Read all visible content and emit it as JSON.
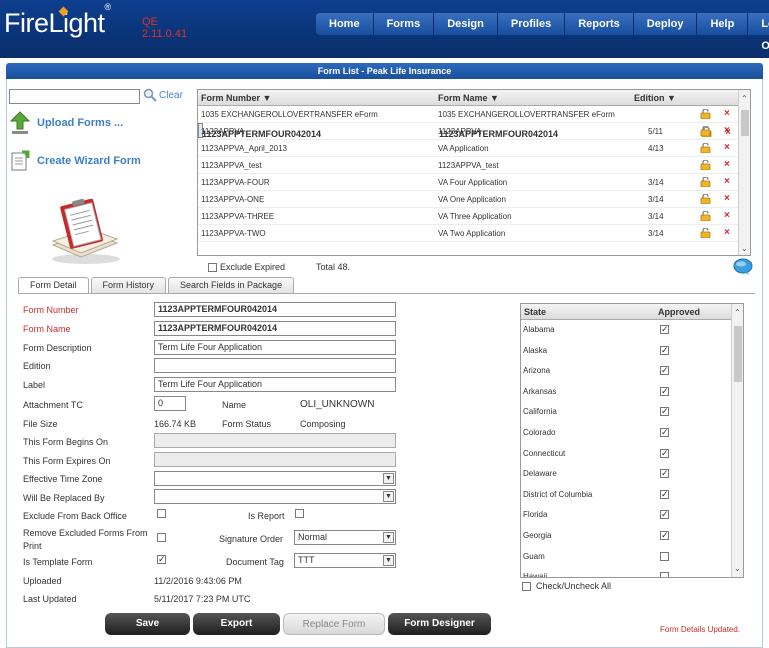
{
  "header": {
    "logo_text": "FireLight",
    "logo_reg": "®",
    "env": "QE",
    "version": "2.11.0.41",
    "nav": [
      "Home",
      "Forms",
      "Design",
      "Profiles",
      "Reports",
      "Deploy",
      "Help",
      "Log Off"
    ]
  },
  "page_title": "Form List - Peak Life Insurance",
  "left": {
    "search_value": "",
    "clear_label": "Clear",
    "upload_label": "Upload Forms ...",
    "wizard_label": "Create Wizard Form"
  },
  "forms_table": {
    "columns": [
      "Form Number ▼",
      "Form Name ▼",
      "Edition ▼"
    ],
    "rows": [
      {
        "number": "1035 EXCHANGEROLLOVERTRANSFER eForm",
        "name": "1035 EXCHANGEROLLOVERTRANSFER eForm",
        "edition": ""
      },
      {
        "number": "1123APPTERMFOUR042014",
        "name": "1123APPTERMFOUR042014",
        "edition": ""
      },
      {
        "number": "1123APPVA",
        "name": "1123APPVA",
        "edition": "5/11"
      },
      {
        "number": "1123APPVA_April_2013",
        "name": "VA Application",
        "edition": "4/13"
      },
      {
        "number": "1123APPVA_test",
        "name": "1123APPVA_test",
        "edition": ""
      },
      {
        "number": "1123APPVA-FOUR",
        "name": "VA Four Application",
        "edition": "3/14"
      },
      {
        "number": "1123APPVA-ONE",
        "name": "VA One Application",
        "edition": "3/14"
      },
      {
        "number": "1123APPVA-THREE",
        "name": "VA Three Application",
        "edition": "3/14"
      },
      {
        "number": "1123APPVA-TWO",
        "name": "VA Two Application",
        "edition": "3/14"
      }
    ],
    "delete_glyph": "×"
  },
  "exclude_expired_label": "Exclude Expired",
  "total_label": "Total 48.",
  "tabs": [
    "Form Detail",
    "Form History",
    "Search Fields in Package"
  ],
  "detail": {
    "form_number_label": "Form Number",
    "form_number": "1123APPTERMFOUR042014",
    "form_name_label": "Form Name",
    "form_name": "1123APPTERMFOUR042014",
    "description_label": "Form Description",
    "description": "Term Life Four Application",
    "edition_label": "Edition",
    "edition": "",
    "label_label": "Label",
    "label": "Term Life Four Application",
    "attachment_label": "Attachment TC",
    "attachment": "0",
    "name_label": "Name",
    "name_value": "OLI_UNKNOWN",
    "file_size_label": "File Size",
    "file_size": "166.74 KB",
    "status_label": "Form Status",
    "status": "Composing",
    "begins_label": "This Form Begins On",
    "expires_label": "This Form Expires On",
    "timezone_label": "Effective Time Zone",
    "replaced_label": "Will Be Replaced By",
    "exclude_back_label": "Exclude From Back Office",
    "is_report_label": "Is Report",
    "remove_excluded_label_1": "Remove Excluded Forms From",
    "remove_excluded_label_2": "Print",
    "signature_label": "Signature Order",
    "signature": "Normal",
    "template_label": "Is Template Form",
    "doc_tag_label": "Document Tag",
    "doc_tag": "TTT",
    "uploaded_label": "Uploaded",
    "uploaded": "11/2/2016 9:43:06 PM",
    "last_updated_label": "Last Updated",
    "last_updated": "5/11/2017 7:23 PM UTC",
    "check_glyph": "✓"
  },
  "states": {
    "columns": [
      "State",
      "Approved"
    ],
    "rows": [
      {
        "name": "Alabama",
        "approved": true
      },
      {
        "name": "Alaska",
        "approved": true
      },
      {
        "name": "Arizona",
        "approved": true
      },
      {
        "name": "Arkansas",
        "approved": true
      },
      {
        "name": "California",
        "approved": true
      },
      {
        "name": "Colorado",
        "approved": true
      },
      {
        "name": "Connecticut",
        "approved": true
      },
      {
        "name": "Delaware",
        "approved": true
      },
      {
        "name": "District of Columbia",
        "approved": true
      },
      {
        "name": "Florida",
        "approved": true
      },
      {
        "name": "Georgia",
        "approved": true
      },
      {
        "name": "Guam",
        "approved": false
      },
      {
        "name": "Hawaii",
        "approved": false
      }
    ],
    "check_all_label": "Check/Uncheck All"
  },
  "buttons": {
    "save": "Save",
    "export": "Export",
    "replace": "Replace Form",
    "designer": "Form Designer"
  },
  "status_message": "Form Details Updated."
}
